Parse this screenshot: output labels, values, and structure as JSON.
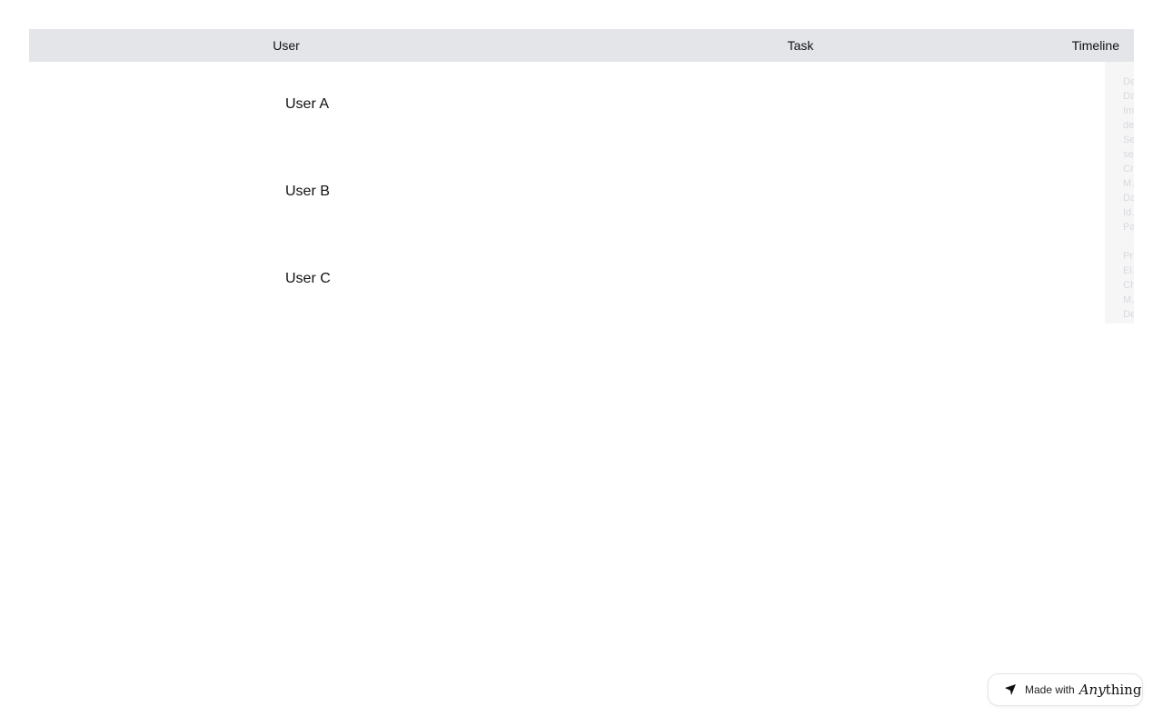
{
  "table": {
    "headers": {
      "user": "User",
      "task": "Task",
      "timeline": "Timeline"
    },
    "rows": [
      {
        "user": "User A",
        "timeline_items": [
          "De…",
          "Da…",
          "Im…",
          "de…",
          "Se…",
          "se…"
        ]
      },
      {
        "user": "User B",
        "timeline_items": [
          "Cr…",
          "M…",
          "Da…",
          "Id…",
          "Pa…"
        ]
      },
      {
        "user": "User C",
        "timeline_items": [
          "Pr…",
          "El…",
          "Ch…",
          "M…",
          "De…"
        ]
      }
    ]
  },
  "badge": {
    "made_with": "Made with",
    "brand_italic": "Any",
    "brand_rest": "thing"
  }
}
